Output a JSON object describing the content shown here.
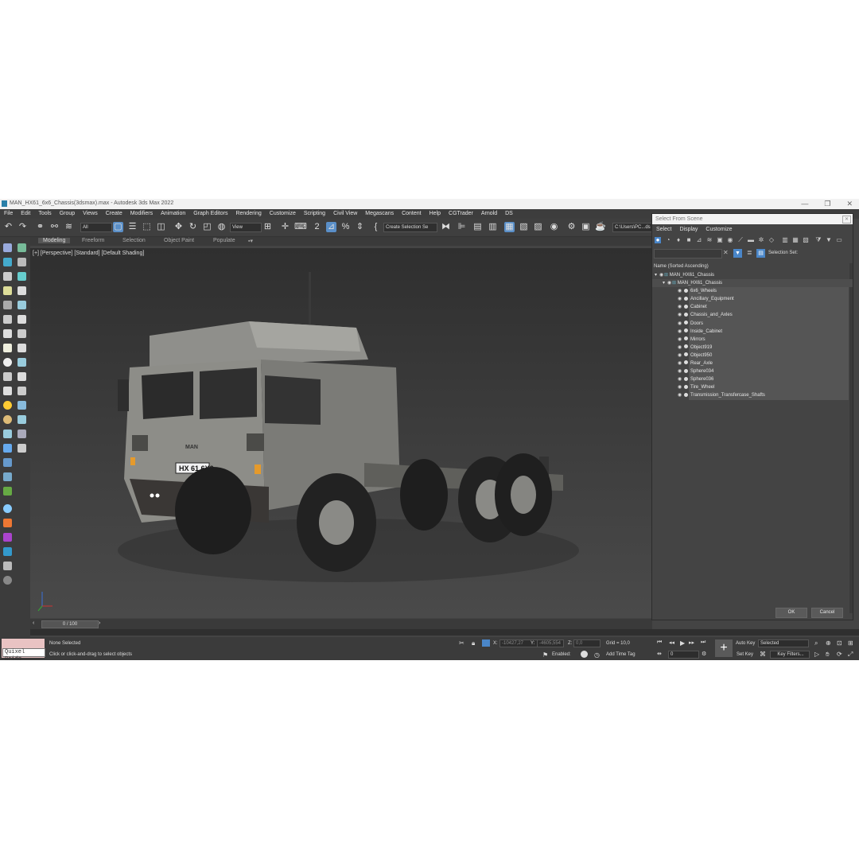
{
  "window": {
    "title": "MAN_HX61_6x6_Chassis(3dsmax).max - Autodesk 3ds Max 2022"
  },
  "menu": [
    "File",
    "Edit",
    "Tools",
    "Group",
    "Views",
    "Create",
    "Modifiers",
    "Animation",
    "Graph Editors",
    "Rendering",
    "Customize",
    "Scripting",
    "Civil View",
    "Megascans",
    "Content",
    "Help",
    "CGTrader",
    "Arnold",
    "DS"
  ],
  "toolbar": {
    "filter": "All",
    "refcoord": "View",
    "selection_set": "Create Selection Se",
    "path": "C:\\Users\\PC...ds"
  },
  "ribbon": {
    "tabs": [
      "Modeling",
      "Freeform",
      "Selection",
      "Object Paint",
      "Populate"
    ]
  },
  "viewport": {
    "label": "[+] [Perspective] [Standard] [Default Shading]",
    "plate": "HX 61 6X6",
    "brand": "MAN"
  },
  "timeline": {
    "frame": "0 / 100"
  },
  "status": {
    "quixel": "Quixel Bridg",
    "selected": "None Selected",
    "hint": "Click or click-and-drag to select objects",
    "x_label": "X:",
    "x": "-10427,27",
    "y_label": "Y:",
    "y": "-4605,554",
    "z_label": "Z:",
    "z": "0,0",
    "grid": "Grid = 10,0",
    "enabled": "Enabled:",
    "add_time_tag": "Add Time Tag",
    "auto_key": "Auto Key",
    "set_key": "Set Key",
    "selected_dd": "Selected",
    "key_filters": "Key Filters...",
    "frame_field": "0"
  },
  "dialog": {
    "title": "Select From Scene",
    "menu": [
      "Select",
      "Display",
      "Customize"
    ],
    "selection_set_label": "Selection Set:",
    "list_header": "Name (Sorted Ascending)",
    "root": "MAN_HX61_Chassis",
    "group": "MAN_HX61_Chassis",
    "items": [
      "6x6_Wheels",
      "Ancillary_Equipment",
      "Cabinet",
      "Chassis_and_Axles",
      "Doors",
      "Inside_Cabinet",
      "Mirrors",
      "Object919",
      "Object950",
      "Rear_Axle",
      "Sphere034",
      "Sphere036",
      "Tire_Wheel",
      "Transmission_Transfercase_Shafts"
    ],
    "ok": "OK",
    "cancel": "Cancel"
  },
  "colors": {
    "accent": "#3a8fd6",
    "panel": "#444444",
    "titlebar": "#f2f2f2"
  }
}
